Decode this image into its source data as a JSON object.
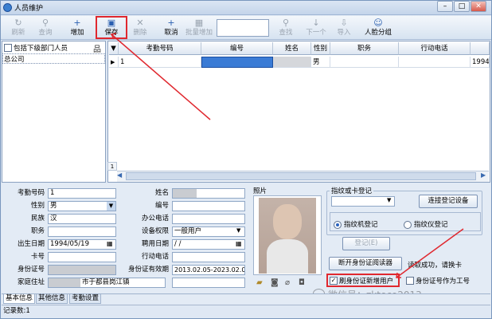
{
  "window": {
    "title": "人员维护",
    "min": "–",
    "max": "□",
    "close": "✕"
  },
  "toolbar": {
    "items": [
      {
        "label": "刷新",
        "icon": "↻",
        "enabled": false
      },
      {
        "label": "查询",
        "icon": "⚲",
        "enabled": false
      },
      {
        "label": "增加",
        "icon": "+",
        "enabled": true
      },
      {
        "label": "保存",
        "icon": "▣",
        "enabled": true
      },
      {
        "label": "删除",
        "icon": "✕",
        "enabled": false
      },
      {
        "label": "取消",
        "icon": "+",
        "enabled": true
      },
      {
        "label": "批量增加",
        "icon": "▦",
        "enabled": false
      },
      {
        "label": "查找",
        "icon": "⚲",
        "enabled": false
      },
      {
        "label": "下一个",
        "icon": "↓",
        "enabled": false
      },
      {
        "label": "导入",
        "icon": "⇩",
        "enabled": false
      },
      {
        "label": "人脸分组",
        "icon": "☺",
        "enabled": true
      }
    ]
  },
  "left": {
    "include_sub_label": "包括下级部门人员",
    "tree_root": "总公司"
  },
  "grid": {
    "columns": [
      "考勤号码",
      "编号",
      "姓名",
      "性别",
      "职务",
      "行动电话"
    ],
    "rows": [
      [
        "1",
        "",
        "",
        "男",
        "",
        "",
        "1994/"
      ]
    ],
    "row_marker": "▶",
    "row_num": "1"
  },
  "form": {
    "labels": {
      "badge": "考勤号码",
      "gender": "性别",
      "nation": "民族",
      "title": "职务",
      "birth": "出生日期",
      "card": "卡号",
      "idno": "身份证号",
      "address": "家庭住址",
      "name": "姓名",
      "number": "编号",
      "office_phone": "办公电话",
      "privilege": "设备权限",
      "hire": "聘用日期",
      "mobile": "行动电话",
      "id_valid": "身份证有效期",
      "photo": "照片"
    },
    "values": {
      "badge": "1",
      "gender": "男",
      "nation": "汉",
      "birth": "1994/05/19",
      "address_tail": "市于都县岗江镇",
      "privilege": "一般用户",
      "hire": " /  / ",
      "id_valid": "2013.02.05-2023.02.05"
    }
  },
  "fingerprint": {
    "group_label": "指纹或卡登记",
    "connect_btn": "连接登记设备",
    "opt_machine": "指纹机登记",
    "opt_reader": "指纹仪登记",
    "register_btn": "登记(E)",
    "id_reader_btn": "断开身份证阅读器",
    "read_status": "读取成功，请换卡",
    "chk_new_user": "刷身份证新增用户",
    "chk_id_as_badge": "身份证号作为工号",
    "chk_new_user_checked": true,
    "chk_id_as_badge_checked": false
  },
  "tabs": [
    "基本信息",
    "其他信息",
    "考勤设置"
  ],
  "status": "记录数:1",
  "watermark": "微信号：zkteco2013"
}
